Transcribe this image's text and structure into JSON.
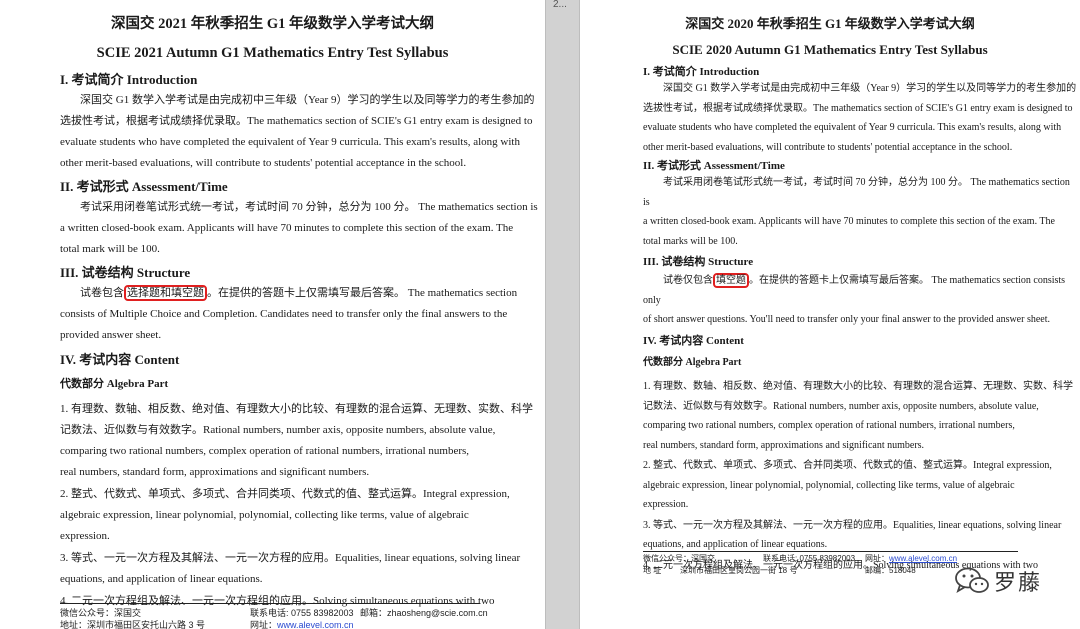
{
  "left_page": {
    "title_cn": "深国交 2021 年秋季招生 G1 年级数学入学考试大纲",
    "title_en": "SCIE 2021 Autumn G1 Mathematics Entry Test Syllabus",
    "s1_heading": "I.  考试简介 Introduction",
    "s1_l1": "深国交 G1 数学入学考试是由完成初中三年级（Year 9）学习的学生以及同等学力的考生参加的",
    "s1_l2": "选拔性考试，根据考试成绩择优录取。The mathematics section of SCIE's G1 entry exam is designed to",
    "s1_l3": "evaluate students who have completed the equivalent of Year 9 curricula. This exam's results, along with",
    "s1_l4": "other merit-based evaluations, will contribute to students' potential acceptance in the school.",
    "s2_heading": "II.  考试形式 Assessment/Time",
    "s2_l1": "考试采用闭卷笔试形式统一考试，考试时间 70 分钟，总分为 100 分。 The mathematics section is",
    "s2_l2": "a written closed-book exam. Applicants will have 70 minutes to complete this section of the exam. The",
    "s2_l3": "total mark will be 100.",
    "s3_heading": "III.  试卷结构 Structure",
    "s3_pre": "试卷包含",
    "s3_hl": "选择题和填空题",
    "s3_post": "。在提供的答题卡上仅需填写最后答案。  The mathematics section",
    "s3_l2": "consists of Multiple Choice and Completion. Candidates need to transfer only the final answers to the",
    "s3_l3": "provided answer sheet.",
    "s4_heading": "IV.  考试内容 Content",
    "s4_sub": "代数部分 Algebra Part",
    "i1_l1": "1. 有理数、数轴、相反数、绝对值、有理数大小的比较、有理数的混合运算、无理数、实数、科学",
    "i1_l2": "记数法、近似数与有效数字。Rational numbers, number axis, opposite numbers, absolute value,",
    "i1_l3": "comparing two rational numbers, complex operation of rational numbers, irrational numbers,",
    "i1_l4": "real numbers, standard form, approximations and significant numbers.",
    "i2_l1": "2. 整式、代数式、单项式、多项式、合并同类项、代数式的值、整式运算。Integral expression,",
    "i2_l2": "algebraic expression, linear polynomial, polynomial, collecting like terms, value of algebraic",
    "i2_l3": "expression.",
    "i3_l1": "3. 等式、一元一次方程及其解法、一元一次方程的应用。Equalities, linear equations, solving linear",
    "i3_l2": "equations, and application of linear equations.",
    "i4_l1": "4. 二元一次方程组及解法、一元一次方程组的应用。Solving   simultaneous   equations   with   two",
    "foot_wechat": "微信公众号：深国交",
    "foot_phone": "联系电话: 0755 83982003",
    "foot_email": "邮箱：zhaosheng@scie.com.cn",
    "foot_addr": "地址：深圳市福田区安托山六路 3 号",
    "foot_web_label": "网址：",
    "foot_web": "www.alevel.com.cn"
  },
  "gap_label": "2...",
  "right_page": {
    "title_cn": "深国交 2020 年秋季招生 G1 年级数学入学考试大纲",
    "title_en": "SCIE 2020 Autumn G1 Mathematics Entry Test Syllabus",
    "s1_heading": "I.  考试简介 Introduction",
    "s1_l1": "深国交 G1 数学入学考试是由完成初中三年级（Year 9）学习的学生以及同等学力的考生参加的",
    "s1_l2": "选拔性考试，根据考试成绩择优录取。The mathematics section of SCIE's G1 entry exam is designed to",
    "s1_l3": "evaluate students who have completed the equivalent of Year 9 curricula. This exam's results, along with",
    "s1_l4": "other merit-based evaluations, will contribute to students' potential acceptance in the school.",
    "s2_heading": "II.  考试形式 Assessment/Time",
    "s2_l1": "考试采用闭卷笔试形式统一考试，考试时间 70 分钟，总分为 100 分。 The mathematics section is",
    "s2_l2": "a written closed-book exam. Applicants will have 70 minutes to complete this section of the exam. The",
    "s2_l3": "total marks will be 100.",
    "s3_heading": "III.  试卷结构 Structure",
    "s3_pre": "试卷仅包含",
    "s3_hl": "填空题",
    "s3_post": "。在提供的答题卡上仅需填写最后答案。 The mathematics section consists only",
    "s3_l2": "of short answer questions. You'll need to transfer only your final answer to the provided answer sheet.",
    "s4_heading": "IV.  考试内容 Content",
    "s4_sub": "代数部分 Algebra Part",
    "i1_l1": "1. 有理数、数轴、相反数、绝对值、有理数大小的比较、有理数的混合运算、无理数、实数、科学",
    "i1_l2": "记数法、近似数与有效数字。Rational numbers, number axis, opposite numbers, absolute value,",
    "i1_l3": "comparing two rational numbers, complex operation of rational numbers, irrational numbers,",
    "i1_l4": "real numbers, standard form, approximations and significant numbers.",
    "i2_l1": "2. 整式、代数式、单项式、多项式、合并同类项、代数式的值、整式运算。Integral expression,",
    "i2_l2": "algebraic expression, linear polynomial, polynomial, collecting like terms, value of algebraic",
    "i2_l3": "expression.",
    "i3_l1": "3. 等式、一元一次方程及其解法、一元一次方程的应用。Equalities, linear equations, solving linear",
    "i3_l2": "equations, and application of linear equations.",
    "i4_l1": "4. 二元一次方程组及解法、一元一次方程组的应用。Solving  simultaneous  equations  with  two",
    "foot_wechat": "微信公众号：深国交",
    "foot_phone": "联系电话: 0755 83982003",
    "foot_web_label": "网址：",
    "foot_web": "www.alevel.com.cn",
    "foot_addr_label": "地    址",
    "foot_addr": "深圳市福田区皇岗公园一街 18 号",
    "foot_post": "邮编：518048"
  },
  "watermark": {
    "icon": "wechat-icon",
    "text": "罗藤"
  }
}
